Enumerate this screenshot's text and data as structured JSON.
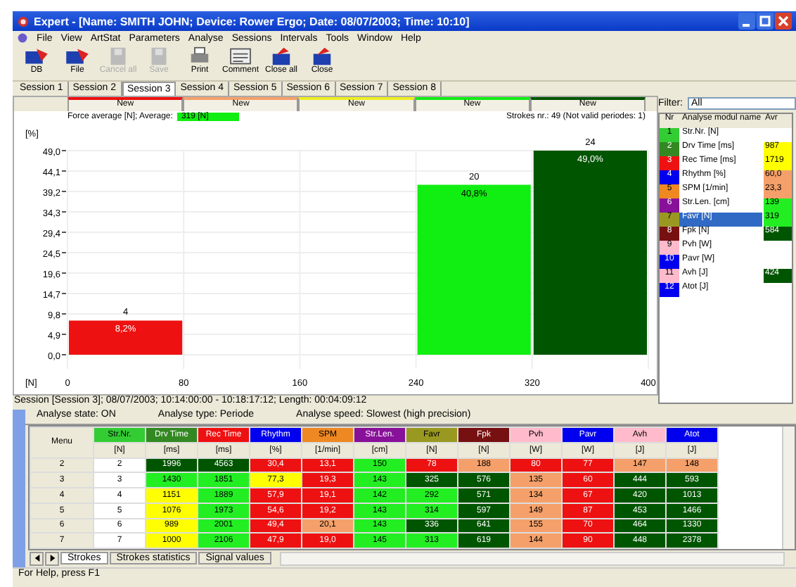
{
  "window": {
    "title": "Expert - [Name: SMITH JOHN; Device: Rower Ergo; Date: 08/07/2003; Time: 10:10]"
  },
  "menu": [
    "File",
    "View",
    "ArtStat",
    "Parameters",
    "Analyse",
    "Sessions",
    "Intervals",
    "Tools",
    "Window",
    "Help"
  ],
  "toolbar": [
    {
      "label": "DB",
      "kind": "folder",
      "disabled": false
    },
    {
      "label": "File",
      "kind": "folder",
      "disabled": false
    },
    {
      "label": "Cancel all",
      "kind": "save",
      "disabled": true
    },
    {
      "label": "Save",
      "kind": "save",
      "disabled": true
    },
    {
      "label": "Print",
      "kind": "print",
      "disabled": false
    },
    {
      "label": "Comment",
      "kind": "comment",
      "disabled": false
    },
    {
      "label": "Close all",
      "kind": "close",
      "disabled": false
    },
    {
      "label": "Close",
      "kind": "close",
      "disabled": false
    }
  ],
  "session_tabs": [
    {
      "label": "Session 1",
      "selected": false
    },
    {
      "label": "Session 2",
      "selected": false
    },
    {
      "label": "Session 3",
      "selected": true
    },
    {
      "label": "Session 4",
      "selected": false
    },
    {
      "label": "Session 5",
      "selected": false
    },
    {
      "label": "Session 6",
      "selected": false
    },
    {
      "label": "Session 7",
      "selected": false
    },
    {
      "label": "Session 8",
      "selected": false
    }
  ],
  "chart": {
    "title": "Force average [N];  Average:",
    "average": "319 [N]",
    "strokes": "Strokes nr.: 49 (Not valid periodes: 1)",
    "bands": [
      {
        "label": "New",
        "color": "#ee1111",
        "count": "4",
        "percent": "8,2%"
      },
      {
        "label": "New",
        "color": "#f5a06a"
      },
      {
        "label": "New",
        "color": "#eeee22"
      },
      {
        "label": "New",
        "color": "#11ee11",
        "count": "20",
        "percent": "40,8%"
      },
      {
        "label": "New",
        "color": "#005500",
        "count": "24",
        "percent": "49,0%"
      }
    ],
    "chart_data": {
      "type": "bar",
      "xlabel": "[N]",
      "ylabel": "[%]",
      "x": [
        40,
        120,
        200,
        280,
        360
      ],
      "series": [
        {
          "values": [
            8.2,
            0,
            0,
            40.8,
            49.0
          ]
        }
      ],
      "xlim": [
        0,
        400
      ],
      "ylim": [
        0,
        49
      ],
      "grid": true,
      "xticks": [
        0,
        80,
        160,
        240,
        320,
        400
      ],
      "yticks": [
        {
          "value": 0,
          "label": "0,0"
        },
        {
          "value": 4.9,
          "label": "4,9"
        },
        {
          "value": 9.8,
          "label": "9,8"
        },
        {
          "value": 14.7,
          "label": "14,7"
        },
        {
          "value": 19.6,
          "label": "19,6"
        },
        {
          "value": 24.5,
          "label": "24,5"
        },
        {
          "value": 29.4,
          "label": "29,4"
        },
        {
          "value": 34.3,
          "label": "34,3"
        },
        {
          "value": 39.2,
          "label": "39,2"
        },
        {
          "value": 44.1,
          "label": "44,1"
        },
        {
          "value": 49,
          "label": "49,0"
        }
      ]
    }
  },
  "filter": {
    "label": "Filter:",
    "value": "All"
  },
  "modules": {
    "columns": [
      "Nr",
      "Analyse modul name",
      "Avr"
    ],
    "rows": [
      {
        "nr": "1",
        "name": "Str.Nr. [N]",
        "color": "#33cc33",
        "selected": false
      },
      {
        "nr": "2",
        "name": "Drv Time [ms]",
        "color": "#338822",
        "avr": {
          "text": "987",
          "color": "#ffff00"
        },
        "selected": false
      },
      {
        "nr": "3",
        "name": "Rec Time [ms]",
        "color": "#ee1111",
        "avr": {
          "text": "1719",
          "color": "#ffff00"
        },
        "selected": false
      },
      {
        "nr": "4",
        "name": "Rhythm [%]",
        "color": "#0000ee",
        "avr": {
          "text": "60,0",
          "color": "#f5a06a"
        },
        "selected": false
      },
      {
        "nr": "5",
        "name": "SPM [1/min]",
        "color": "#ee8822",
        "avr": {
          "text": "23,3",
          "color": "#f5a06a"
        },
        "selected": false
      },
      {
        "nr": "6",
        "name": "Str.Len. [cm]",
        "color": "#881199",
        "avr": {
          "text": "139",
          "color": "#22ee22"
        },
        "selected": false
      },
      {
        "nr": "7",
        "name": "Favr [N]",
        "color": "#999922",
        "avr": {
          "text": "319",
          "color": "#22ee22"
        },
        "selected": true
      },
      {
        "nr": "8",
        "name": "Fpk [N]",
        "color": "#771111",
        "avr": {
          "text": "584",
          "color": "#005500"
        },
        "selected": false
      },
      {
        "nr": "9",
        "name": "Pvh [W]",
        "color": "#ffbbcc",
        "selected": false
      },
      {
        "nr": "10",
        "name": "Pavr [W]",
        "color": "#0000ee",
        "selected": false
      },
      {
        "nr": "11",
        "name": "Avh [J]",
        "color": "#ffbbcc",
        "avr": {
          "text": "424",
          "color": "#005500"
        },
        "selected": false
      },
      {
        "nr": "12",
        "name": "Atot [J]",
        "color": "#0000ee",
        "selected": false
      }
    ]
  },
  "session_info": "Session [Session 3]; 08/07/2003; 10:14:00:00 - 10:18:17:12; Length: 00:04:09:12",
  "analysis": [
    "Analyse state:  ON",
    "Analyse type:  Periode",
    "Analyse speed: Slowest (high precision)"
  ],
  "table": {
    "menu_label": "Menu",
    "columns": [
      {
        "name": "Str.Nr.",
        "unit": "[N]",
        "color": "#33cc33"
      },
      {
        "name": "Drv Time",
        "unit": "[ms]",
        "color": "#338822"
      },
      {
        "name": "Rec Time",
        "unit": "[ms]",
        "color": "#ee1111"
      },
      {
        "name": "Rhythm",
        "unit": "[%]",
        "color": "#0000ee"
      },
      {
        "name": "SPM",
        "unit": "[1/min]",
        "color": "#ee8822"
      },
      {
        "name": "Str.Len.",
        "unit": "[cm]",
        "color": "#881199"
      },
      {
        "name": "Favr",
        "unit": "[N]",
        "color": "#999922"
      },
      {
        "name": "Fpk",
        "unit": "[N]",
        "color": "#771111"
      },
      {
        "name": "Pvh",
        "unit": "[W]",
        "color": "#ffbbcc"
      },
      {
        "name": "Pavr",
        "unit": "[W]",
        "color": "#0000ee"
      },
      {
        "name": "Avh",
        "unit": "[J]",
        "color": "#ffbbcc"
      },
      {
        "name": "Atot",
        "unit": "[J]",
        "color": "#0000ee"
      }
    ],
    "rows": [
      {
        "menu": "2",
        "cells": [
          {
            "text": "2",
            "color": "#ffffff"
          },
          {
            "text": "1996",
            "color": "#005500"
          },
          {
            "text": "4563",
            "color": "#005500"
          },
          {
            "text": "30,4",
            "color": "#ee1111"
          },
          {
            "text": "13,1",
            "color": "#ee1111"
          },
          {
            "text": "150",
            "color": "#22ee22"
          },
          {
            "text": "78",
            "color": "#ee1111"
          },
          {
            "text": "188",
            "color": "#f5a06a"
          },
          {
            "text": "80",
            "color": "#ee1111"
          },
          {
            "text": "77",
            "color": "#ee1111"
          },
          {
            "text": "147",
            "color": "#f5a06a"
          },
          {
            "text": "148",
            "color": "#f5a06a"
          }
        ]
      },
      {
        "menu": "3",
        "cells": [
          {
            "text": "3",
            "color": "#ffffff"
          },
          {
            "text": "1430",
            "color": "#22ee22"
          },
          {
            "text": "1851",
            "color": "#22ee22"
          },
          {
            "text": "77,3",
            "color": "#ffff00"
          },
          {
            "text": "19,3",
            "color": "#ee1111"
          },
          {
            "text": "143",
            "color": "#22ee22"
          },
          {
            "text": "325",
            "color": "#005500"
          },
          {
            "text": "576",
            "color": "#005500"
          },
          {
            "text": "135",
            "color": "#f5a06a"
          },
          {
            "text": "60",
            "color": "#ee1111"
          },
          {
            "text": "444",
            "color": "#005500"
          },
          {
            "text": "593",
            "color": "#005500"
          }
        ]
      },
      {
        "menu": "4",
        "cells": [
          {
            "text": "4",
            "color": "#ffffff"
          },
          {
            "text": "1151",
            "color": "#ffff00"
          },
          {
            "text": "1889",
            "color": "#22ee22"
          },
          {
            "text": "57,9",
            "color": "#ee1111"
          },
          {
            "text": "19,1",
            "color": "#ee1111"
          },
          {
            "text": "142",
            "color": "#22ee22"
          },
          {
            "text": "292",
            "color": "#22ee22"
          },
          {
            "text": "571",
            "color": "#005500"
          },
          {
            "text": "134",
            "color": "#f5a06a"
          },
          {
            "text": "67",
            "color": "#ee1111"
          },
          {
            "text": "420",
            "color": "#005500"
          },
          {
            "text": "1013",
            "color": "#005500"
          }
        ]
      },
      {
        "menu": "5",
        "cells": [
          {
            "text": "5",
            "color": "#ffffff"
          },
          {
            "text": "1076",
            "color": "#ffff00"
          },
          {
            "text": "1973",
            "color": "#22ee22"
          },
          {
            "text": "54,6",
            "color": "#ee1111"
          },
          {
            "text": "19,2",
            "color": "#ee1111"
          },
          {
            "text": "143",
            "color": "#22ee22"
          },
          {
            "text": "314",
            "color": "#22ee22"
          },
          {
            "text": "597",
            "color": "#005500"
          },
          {
            "text": "149",
            "color": "#f5a06a"
          },
          {
            "text": "87",
            "color": "#ee1111"
          },
          {
            "text": "453",
            "color": "#005500"
          },
          {
            "text": "1466",
            "color": "#005500"
          }
        ]
      },
      {
        "menu": "6",
        "cells": [
          {
            "text": "6",
            "color": "#ffffff"
          },
          {
            "text": "989",
            "color": "#ffff00"
          },
          {
            "text": "2001",
            "color": "#22ee22"
          },
          {
            "text": "49,4",
            "color": "#ee1111"
          },
          {
            "text": "20,1",
            "color": "#f5a06a"
          },
          {
            "text": "143",
            "color": "#22ee22"
          },
          {
            "text": "336",
            "color": "#005500"
          },
          {
            "text": "641",
            "color": "#005500"
          },
          {
            "text": "155",
            "color": "#f5a06a"
          },
          {
            "text": "70",
            "color": "#ee1111"
          },
          {
            "text": "464",
            "color": "#005500"
          },
          {
            "text": "1330",
            "color": "#005500"
          }
        ]
      },
      {
        "menu": "7",
        "cells": [
          {
            "text": "7",
            "color": "#ffffff"
          },
          {
            "text": "1000",
            "color": "#ffff00"
          },
          {
            "text": "2106",
            "color": "#22ee22"
          },
          {
            "text": "47,9",
            "color": "#ee1111"
          },
          {
            "text": "19,0",
            "color": "#ee1111"
          },
          {
            "text": "145",
            "color": "#22ee22"
          },
          {
            "text": "313",
            "color": "#22ee22"
          },
          {
            "text": "619",
            "color": "#005500"
          },
          {
            "text": "144",
            "color": "#f5a06a"
          },
          {
            "text": "90",
            "color": "#ee1111"
          },
          {
            "text": "448",
            "color": "#005500"
          },
          {
            "text": "2378",
            "color": "#005500"
          }
        ]
      }
    ]
  },
  "bottom_tabs": [
    {
      "label": "Strokes",
      "selected": true
    },
    {
      "label": "Strokes statistics",
      "selected": false
    },
    {
      "label": "Signal values",
      "selected": false
    }
  ],
  "status_bar": "For Help, press F1"
}
